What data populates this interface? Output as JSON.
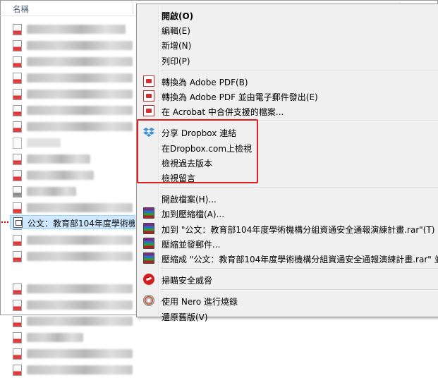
{
  "explorer": {
    "column_header": "名稱",
    "rows": [
      {
        "icon": "red-doc",
        "style": "blur",
        "w": 140
      },
      {
        "icon": "red-doc",
        "style": "blur",
        "w": 150
      },
      {
        "icon": "red-doc",
        "style": "blur",
        "w": 150
      },
      {
        "icon": "red-doc",
        "style": "blur",
        "w": 150
      },
      {
        "icon": "red-doc",
        "style": "blur",
        "w": 150
      },
      {
        "icon": "red-doc",
        "style": "blur",
        "w": 150
      },
      {
        "icon": "red-doc",
        "style": "blur",
        "w": 150
      },
      {
        "icon": "blank-doc",
        "style": "light",
        "w": 48
      },
      {
        "icon": "red-doc",
        "style": "blur",
        "w": 90
      },
      {
        "icon": "red-doc",
        "style": "blur",
        "w": 95
      },
      {
        "icon": "gray-doc",
        "style": "blur",
        "w": 70
      },
      {
        "icon": "red-doc",
        "style": "blur",
        "w": 150
      },
      {
        "icon": "gray-doc",
        "style": "blur",
        "w": 150
      },
      {
        "icon": "red-doc",
        "style": "blur",
        "w": 150
      },
      {
        "icon": "red-doc",
        "style": "blur",
        "w": 150
      },
      {
        "icon": "selected",
        "style": "none",
        "w": 0
      },
      {
        "icon": "red-doc",
        "style": "blur",
        "w": 150
      },
      {
        "icon": "red-doc",
        "style": "blur",
        "w": 150
      },
      {
        "icon": "red-doc",
        "style": "blur",
        "w": 150
      },
      {
        "icon": "red-doc",
        "style": "blur",
        "w": 80
      },
      {
        "icon": "red-doc",
        "style": "blur",
        "w": 150
      },
      {
        "icon": "red-doc",
        "style": "blur",
        "w": 150
      }
    ],
    "selected_file": {
      "prefix": "公文：",
      "name": "教育部104年度學術機"
    }
  },
  "context_menu": {
    "groups": [
      [
        {
          "label": "開啟(O)",
          "bold": true,
          "icon": ""
        },
        {
          "label": "編輯(E)",
          "icon": ""
        },
        {
          "label": "新增(N)",
          "icon": ""
        },
        {
          "label": "列印(P)",
          "icon": ""
        }
      ],
      [
        {
          "label": "轉換為 Adobe PDF(B)",
          "icon": "pdf-icon"
        },
        {
          "label": "轉換為 Adobe PDF 並由電子郵件發出(E)",
          "icon": "pdf-mail-icon"
        },
        {
          "label": "在 Acrobat 中合併支援的檔案...",
          "icon": "pdf-combine-icon"
        }
      ],
      [
        {
          "label": "分享 Dropbox 連結",
          "icon": "dropbox-icon"
        },
        {
          "label": "在Dropbox.com上檢視",
          "icon": ""
        },
        {
          "label": "檢視過去版本",
          "icon": ""
        },
        {
          "label": "檢視留言",
          "icon": ""
        }
      ],
      [
        {
          "label": "開啟檔案(H)...",
          "icon": ""
        },
        {
          "label": "加到壓縮檔(A)...",
          "icon": "rar-icon"
        },
        {
          "label": "加到 \"公文：教育部104年度學術機構分組資通安全通報演練計畫.rar\"(T)",
          "icon": "rar-icon"
        },
        {
          "label": "壓縮並發郵件...",
          "icon": "rar-icon"
        },
        {
          "label": "壓縮成 \"公文：教育部104年度學術機構分組資通安全通報演練計畫.rar\" 並",
          "icon": "rar-icon"
        }
      ],
      [
        {
          "label": "掃瞄安全威脅",
          "icon": "trend-micro-icon"
        }
      ],
      [
        {
          "label": "使用 Nero 進行燒錄",
          "icon": "nero-icon"
        },
        {
          "label": "還原舊版(V)",
          "icon": ""
        }
      ]
    ]
  },
  "colors": {
    "highlight_box": "#e02020",
    "selection_fill": "#cde8ff",
    "arrow": "#d40000"
  }
}
